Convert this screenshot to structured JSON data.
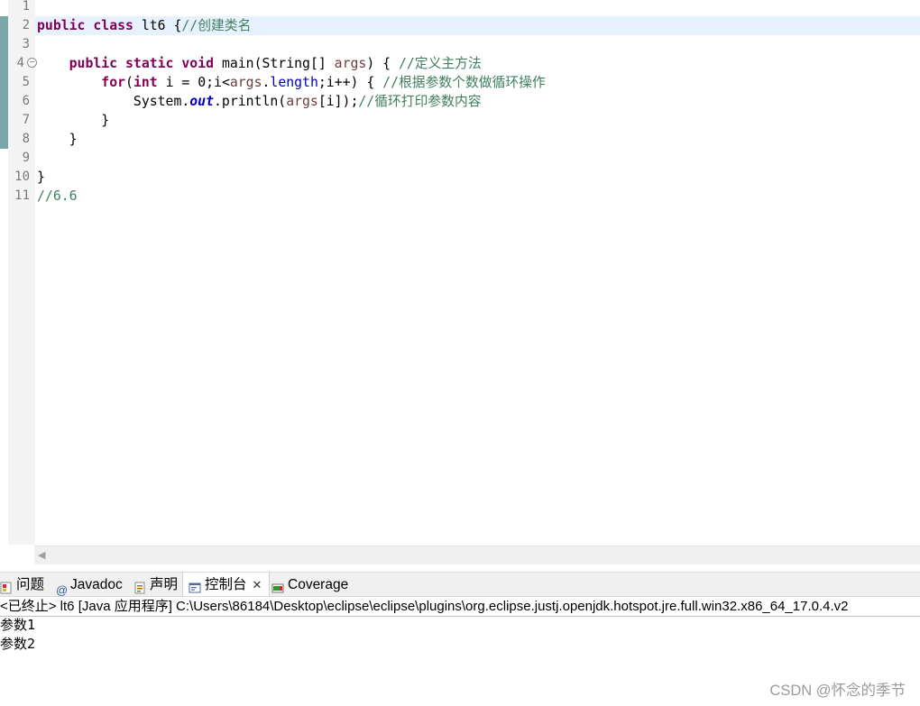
{
  "editor": {
    "line_numbers": [
      "1",
      "2",
      "3",
      "4",
      "5",
      "6",
      "7",
      "8",
      "9",
      "10",
      "11"
    ],
    "lines": {
      "l2": {
        "kw1": "public",
        "kw2": "class",
        "name": "lt6 {",
        "comment": "//创建类名"
      },
      "l4": {
        "kw1": "public",
        "kw2": "static",
        "kw3": "void",
        "sig": "main(String[] ",
        "param": "args",
        "close": ") {",
        "comment": "//定义主方法"
      },
      "l5": {
        "kw1": "for",
        "paren": "(",
        "kw2": "int",
        "a": " i = 0;i<",
        "b": "args",
        "c": ".",
        "len": "length",
        "d": ";i++) {",
        "comment": "//根据参数个数做循环操作"
      },
      "l6": {
        "a": "System.",
        "out": "out",
        "b": ".println(",
        "args": "args",
        "c": "[i]);",
        "comment": "//循环打印参数内容"
      },
      "l7": "}",
      "l8": "}",
      "l10": "}",
      "l11": "//6.6"
    }
  },
  "panel": {
    "tabs": {
      "problems": "问题",
      "javadoc": "Javadoc",
      "declaration": "声明",
      "console": "控制台",
      "coverage": "Coverage"
    },
    "console_header": "<已终止> lt6 [Java 应用程序] C:\\Users\\86184\\Desktop\\eclipse\\eclipse\\plugins\\org.eclipse.justj.openjdk.hotspot.jre.full.win32.x86_64_17.0.4.v2",
    "output": [
      "参数1",
      "参数2"
    ]
  },
  "watermark": "CSDN @怀念的季节",
  "colors": {
    "keyword": "#7f0055",
    "comment": "#3f7f5f",
    "field": "#0000c0",
    "variable": "#6a3e3e",
    "current_line": "#e8f2fe",
    "change_bar": "#7aa8a8"
  }
}
